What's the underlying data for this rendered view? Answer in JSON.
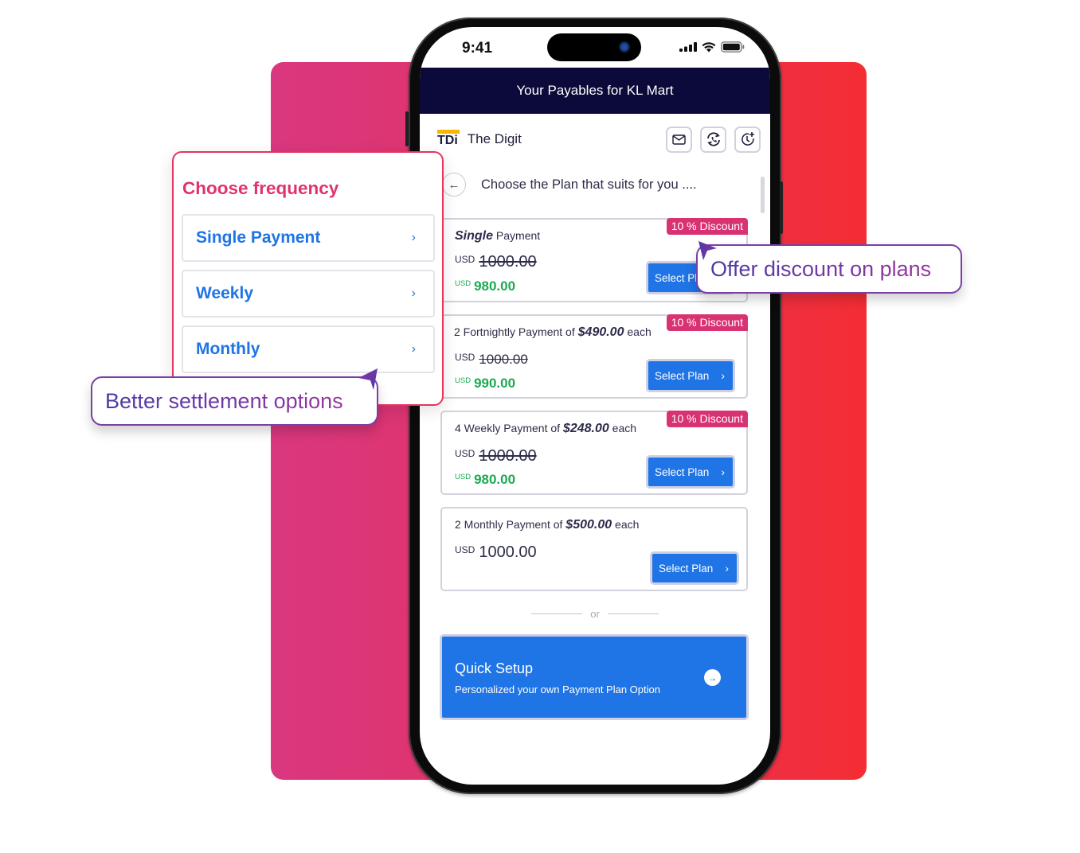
{
  "status_bar": {
    "time": "9:41"
  },
  "app_header": {
    "title": "Your Payables for KL Mart"
  },
  "brand": {
    "logo": "TDi",
    "name": "The Digit"
  },
  "header_icons": [
    "mail-icon",
    "refresh-phone-icon",
    "clock-add-icon"
  ],
  "page": {
    "title": "Choose the Plan that suits for you ...."
  },
  "plans": [
    {
      "desc_bold": "Single",
      "desc_rest": " Payment",
      "badge": "10 % Discount",
      "currency": "USD",
      "original": "1000.00",
      "discount_currency": "USD",
      "discounted": "980.00",
      "button": "Select Plan"
    },
    {
      "desc_pre": "2 Fortnightly Payment of ",
      "desc_amount": "$490.00",
      "desc_post": " each",
      "badge": "10 % Discount",
      "currency": "USD",
      "original": "1000.00",
      "discount_currency": "USD",
      "discounted": "990.00",
      "button": "Select Plan"
    },
    {
      "desc_pre": "4 Weekly Payment of ",
      "desc_amount": "$248.00",
      "desc_post": " each",
      "badge": "10 % Discount",
      "currency": "USD",
      "original": "1000.00",
      "discount_currency": "USD",
      "discounted": "980.00",
      "button": "Select Plan"
    },
    {
      "desc_pre": "2 Monthly Payment of ",
      "desc_amount": "$500.00",
      "desc_post": " each",
      "currency": "USD",
      "amount": "1000.00",
      "button": "Select Plan"
    }
  ],
  "divider": {
    "label": "or"
  },
  "quick_setup": {
    "title": "Quick Setup",
    "subtitle": "Personalized your own Payment Plan Option"
  },
  "frequency": {
    "title": "Choose frequency",
    "items": [
      "Single Payment",
      "Weekly",
      "Monthly"
    ]
  },
  "callouts": {
    "discount": "Offer discount on plans",
    "settlement": "Better settlement options"
  },
  "colors": {
    "header_bg": "#0b0a3a",
    "primary": "#1f74e6",
    "discount_badge": "#d93273",
    "discount_price": "#1aaa52",
    "accent_pink": "#e0336a"
  }
}
